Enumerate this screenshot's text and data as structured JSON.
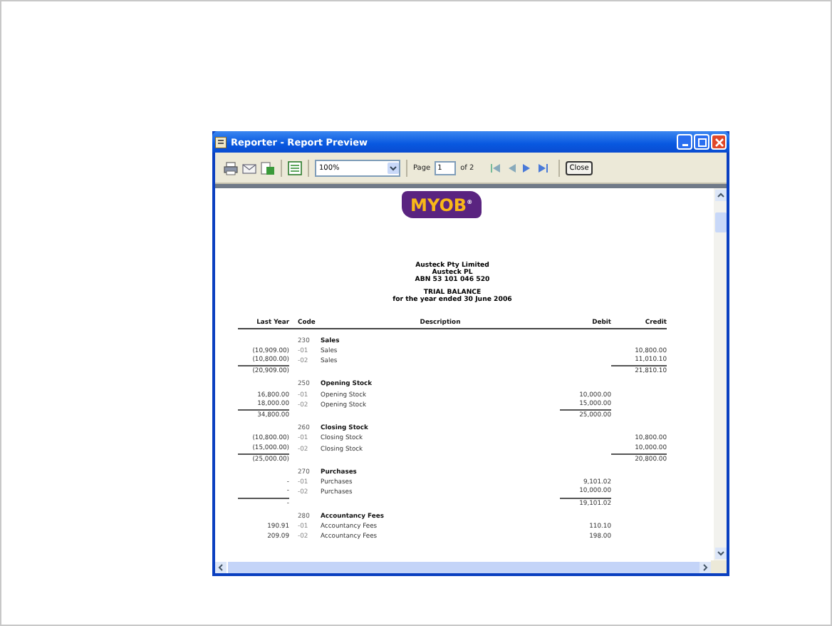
{
  "window": {
    "title": "Reporter - Report Preview"
  },
  "toolbar": {
    "zoom": "100%",
    "page_label": "Page",
    "page": "1",
    "page_count": "of 2",
    "close": "Close"
  },
  "report": {
    "logo": "MYOB$^{®}$",
    "header_lines": [
      "Austeck Pty Limited",
      "Austeck PL",
      "ABN 53 101 046 520"
    ],
    "title": "TRIAL BALANCE",
    "subtitle": "for the year ended 30 June 2006",
    "columns": [
      "Last Year",
      "Code",
      "Description",
      "Debit",
      "Credit"
    ],
    "sections": [
      {
        "code": "230",
        "name": "Sales",
        "lines": [
          {
            "last_year": "(10,909.00)",
            "code": "-01",
            "description": "Sales",
            "credit": "10,800.00"
          },
          {
            "last_year": "(10,800.00)",
            "code": "-02",
            "description": "Sales",
            "credit": "11,010.10"
          }
        ],
        "total": {
          "last_year": "(20,909.00)",
          "credit": "21,810.10"
        }
      },
      {
        "code": "250",
        "name": "Opening Stock",
        "lines": [
          {
            "last_year": "16,800.00",
            "code": "-01",
            "description": "Opening Stock",
            "debit": "10,000.00"
          },
          {
            "last_year": "18,000.00",
            "code": "-02",
            "description": "Opening Stock",
            "debit": "15,000.00"
          }
        ],
        "total": {
          "last_year": "34,800.00",
          "debit": "25,000.00"
        }
      },
      {
        "code": "260",
        "name": "Closing Stock",
        "lines": [
          {
            "last_year": "(10,800.00)",
            "code": "-01",
            "description": "Closing Stock",
            "credit": "10,800.00"
          },
          {
            "last_year": "(15,000.00)",
            "code": "-02",
            "description": "Closing Stock",
            "credit": "10,000.00"
          }
        ],
        "total": {
          "last_year": "(25,000.00)",
          "credit": "20,800.00"
        }
      },
      {
        "code": "270",
        "name": "Purchases",
        "lines": [
          {
            "last_year": "-",
            "code": "-01",
            "description": "Purchases",
            "debit": "9,101.02"
          },
          {
            "last_year": "-",
            "code": "-02",
            "description": "Purchases",
            "debit": "10,000.00"
          }
        ],
        "total": {
          "last_year": "-",
          "debit": "19,101.02"
        }
      },
      {
        "code": "280",
        "name": "Accountancy Fees",
        "lines": [
          {
            "last_year": "190.91",
            "code": "-01",
            "description": "Accountancy Fees",
            "debit": "110.10"
          },
          {
            "last_year": "209.09",
            "code": "-02",
            "description": "Accountancy Fees",
            "debit": "198.00"
          }
        ]
      }
    ]
  }
}
